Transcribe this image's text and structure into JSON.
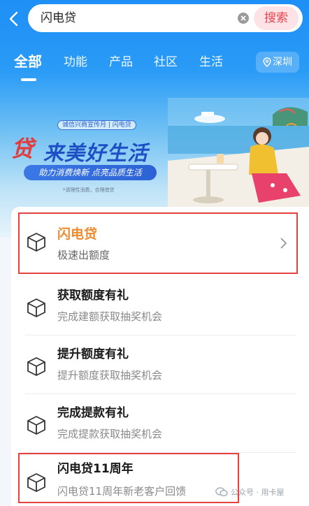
{
  "search": {
    "query": "闪电贷",
    "button_label": "搜索"
  },
  "tabs": [
    {
      "label": "全部",
      "active": true
    },
    {
      "label": "功能",
      "active": false
    },
    {
      "label": "产品",
      "active": false
    },
    {
      "label": "社区",
      "active": false
    },
    {
      "label": "生活",
      "active": false
    }
  ],
  "city": "深圳",
  "banner": {
    "tag": "诚信兴商宣传月 | 闪电贷",
    "logo_char": "贷",
    "title": "来美好生活",
    "subtitle": "助力消费焕新  点亮品质生活",
    "note": "*请理性消费，合理借贷"
  },
  "results": [
    {
      "title": "闪电贷",
      "subtitle": "极速出额度",
      "highlighted": true,
      "title_color": "#f08a2c",
      "has_chevron": true
    },
    {
      "title": "获取额度有礼",
      "subtitle": "完成建额获取抽奖机会",
      "highlighted": false
    },
    {
      "title": "提升额度有礼",
      "subtitle": "提升额度获取抽奖机会",
      "highlighted": false
    },
    {
      "title": "完成提款有礼",
      "subtitle": "完成提款获取抽奖机会",
      "highlighted": false
    },
    {
      "title": "闪电贷11周年",
      "subtitle": "闪电贷11周年新老客户回馈",
      "highlighted": true
    }
  ],
  "watermark": "公众号 · 用卡屋",
  "colors": {
    "accent_orange": "#f08a2c",
    "highlight_red": "#e5413f",
    "brand_blue": "#1e8ff5"
  }
}
